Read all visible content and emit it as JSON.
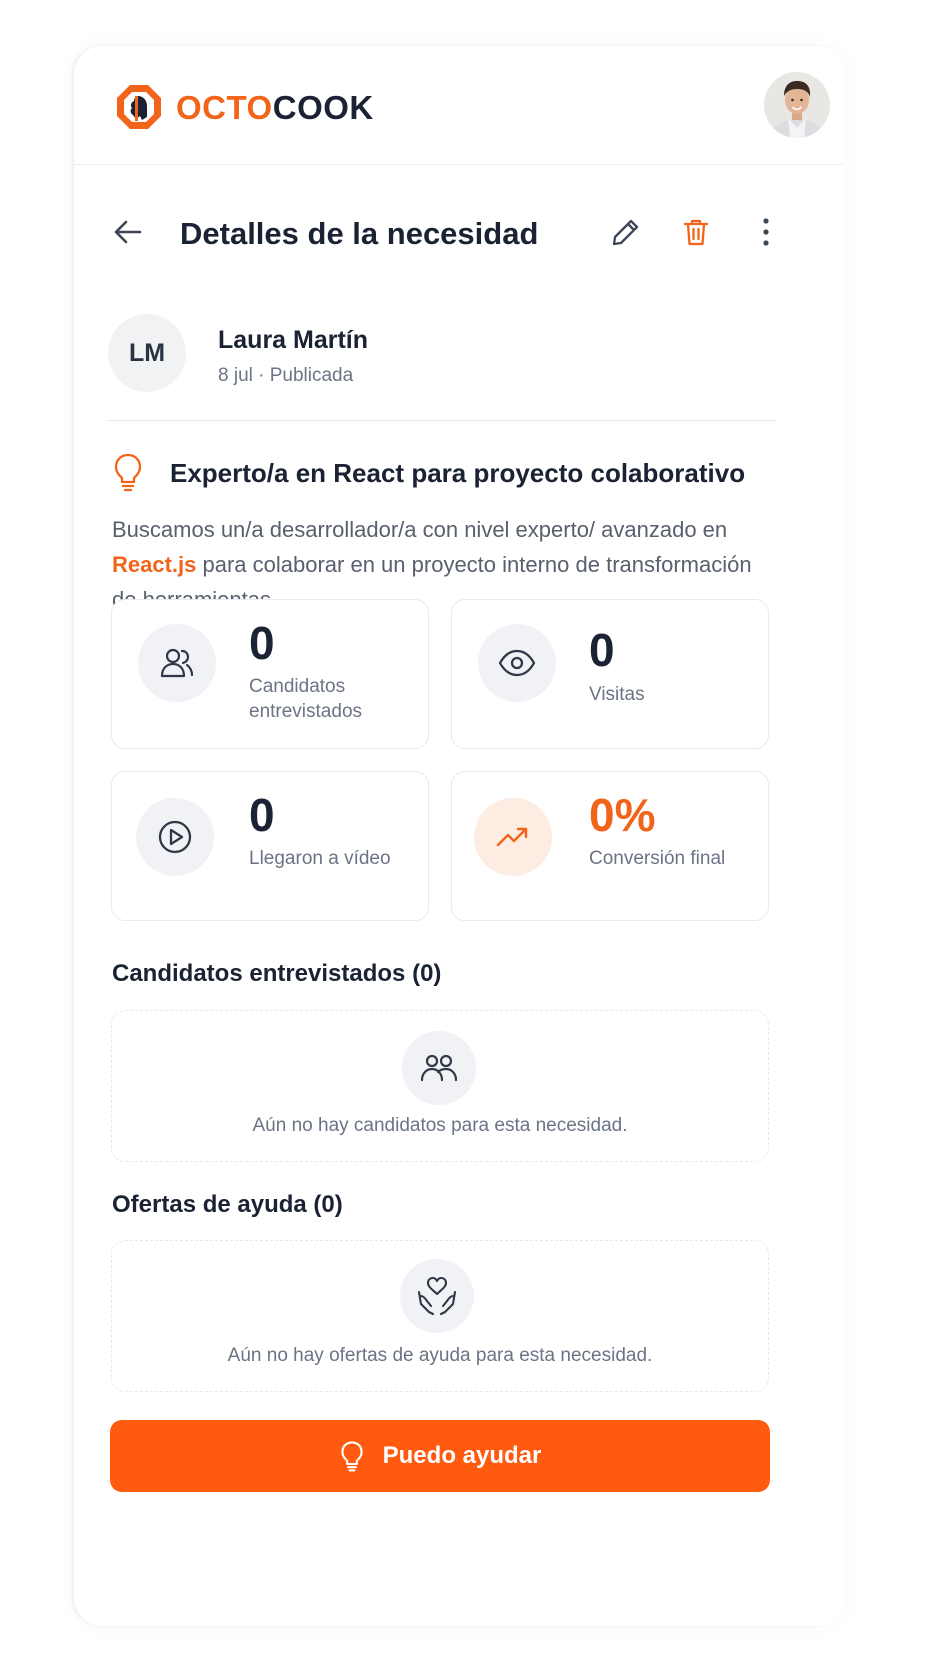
{
  "brand": {
    "name_part1": "OCTO",
    "name_part2": "COOK",
    "accent_color": "#f26419"
  },
  "header": {
    "title": "Detalles de la necesidad",
    "icons": [
      "arrow-left-icon",
      "pencil-icon",
      "trash-icon",
      "more-vertical-icon"
    ]
  },
  "author": {
    "initials": "LM",
    "name": "Laura Martín",
    "meta": "8 jul · Publicada"
  },
  "need": {
    "title": "Experto/a en React para proyecto colaborativo",
    "description_before": "Buscamos un/a desarrollador/a con nivel experto/ avanzado en ",
    "description_highlight": "React.js",
    "description_after": " para colaborar en un proyecto interno de transformación de herramientas."
  },
  "stats": [
    {
      "value": "0",
      "label": "Candidatos entrevistados",
      "icon": "users-icon"
    },
    {
      "value": "0",
      "label": "Visitas",
      "icon": "eye-icon"
    },
    {
      "value": "0",
      "label": "Llegaron a vídeo",
      "icon": "play-circle-icon"
    },
    {
      "value": "0%",
      "label": "Conversión final",
      "icon": "trending-up-icon"
    }
  ],
  "sections": {
    "candidates_title": "Candidatos entrevistados (0)",
    "candidates_empty": "Aún no hay candidatos para esta necesidad.",
    "offers_title": "Ofertas de ayuda (0)",
    "offers_empty": "Aún no hay ofertas de ayuda para esta necesidad."
  },
  "cta": {
    "label": "Puedo ayudar"
  }
}
